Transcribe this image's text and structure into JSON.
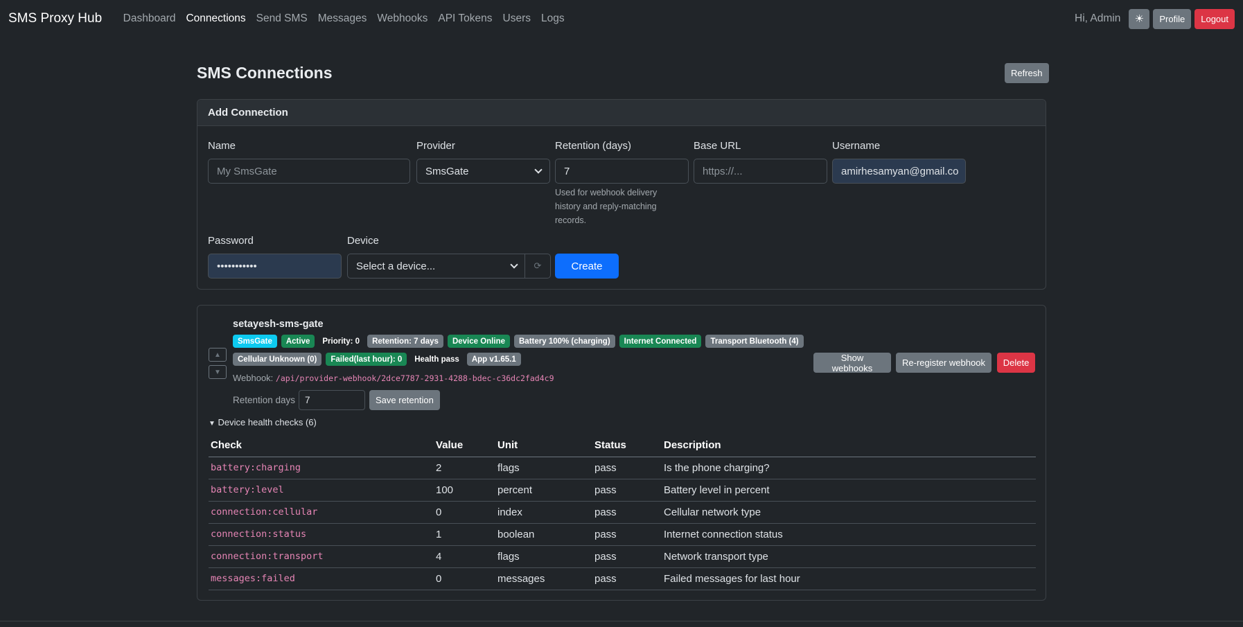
{
  "nav": {
    "brand": "SMS Proxy Hub",
    "links": [
      "Dashboard",
      "Connections",
      "Send SMS",
      "Messages",
      "Webhooks",
      "API Tokens",
      "Users",
      "Logs"
    ],
    "active": "Connections",
    "greeting": "Hi, Admin",
    "theme_icon": "☀",
    "profile": "Profile",
    "logout": "Logout"
  },
  "page": {
    "title": "SMS Connections",
    "refresh": "Refresh"
  },
  "add_form": {
    "header": "Add Connection",
    "name_label": "Name",
    "name_placeholder": "My SmsGate",
    "provider_label": "Provider",
    "provider_value": "SmsGate",
    "retention_label": "Retention (days)",
    "retention_value": "7",
    "retention_help": "Used for webhook delivery history and reply-matching records.",
    "base_url_label": "Base URL",
    "base_url_placeholder": "https://...",
    "username_label": "Username",
    "username_value": "amirhesamyan@gmail.co",
    "password_label": "Password",
    "password_value": "•••••••••••",
    "device_label": "Device",
    "device_value": "Select a device...",
    "device_refresh_icon": "⟳",
    "create": "Create"
  },
  "connection": {
    "name": "setayesh-sms-gate",
    "badges_row1": [
      {
        "text": "SmsGate",
        "color": "#0dcaf0"
      },
      {
        "text": "Active",
        "color": "#198754"
      },
      {
        "text": "Priority: 0",
        "color": "transparent"
      },
      {
        "text": "Retention: 7 days",
        "color": "#6c757d"
      },
      {
        "text": "Device Online",
        "color": "#198754"
      },
      {
        "text": "Battery 100% (charging)",
        "color": "#6c757d"
      },
      {
        "text": "Internet Connected",
        "color": "#198754"
      },
      {
        "text": "Transport Bluetooth (4)",
        "color": "#6c757d"
      }
    ],
    "badges_row2": [
      {
        "text": "Cellular Unknown (0)",
        "color": "#6c757d"
      },
      {
        "text": "Failed(last hour): 0",
        "color": "#198754"
      },
      {
        "text": "Health pass",
        "color": "transparent"
      },
      {
        "text": "App v1.65.1",
        "color": "#6c757d"
      }
    ],
    "webhook_label": "Webhook:",
    "webhook_path": "/api/provider-webhook/2dce7787-2931-4288-bdec-c36dc2fad4c9",
    "retention_days_label": "Retention days",
    "retention_days_value": "7",
    "save_retention": "Save retention",
    "show_webhooks": "Show webhooks",
    "reregister": "Re-register webhook",
    "delete": "Delete",
    "health_summary": "Device health checks (6)",
    "table": {
      "columns": [
        "Check",
        "Value",
        "Unit",
        "Status",
        "Description"
      ],
      "rows": [
        [
          "battery:charging",
          "2",
          "flags",
          "pass",
          "Is the phone charging?"
        ],
        [
          "battery:level",
          "100",
          "percent",
          "pass",
          "Battery level in percent"
        ],
        [
          "connection:cellular",
          "0",
          "index",
          "pass",
          "Cellular network type"
        ],
        [
          "connection:status",
          "1",
          "boolean",
          "pass",
          "Internet connection status"
        ],
        [
          "connection:transport",
          "4",
          "flags",
          "pass",
          "Network transport type"
        ],
        [
          "messages:failed",
          "0",
          "messages",
          "pass",
          "Failed messages for last hour"
        ]
      ]
    }
  }
}
